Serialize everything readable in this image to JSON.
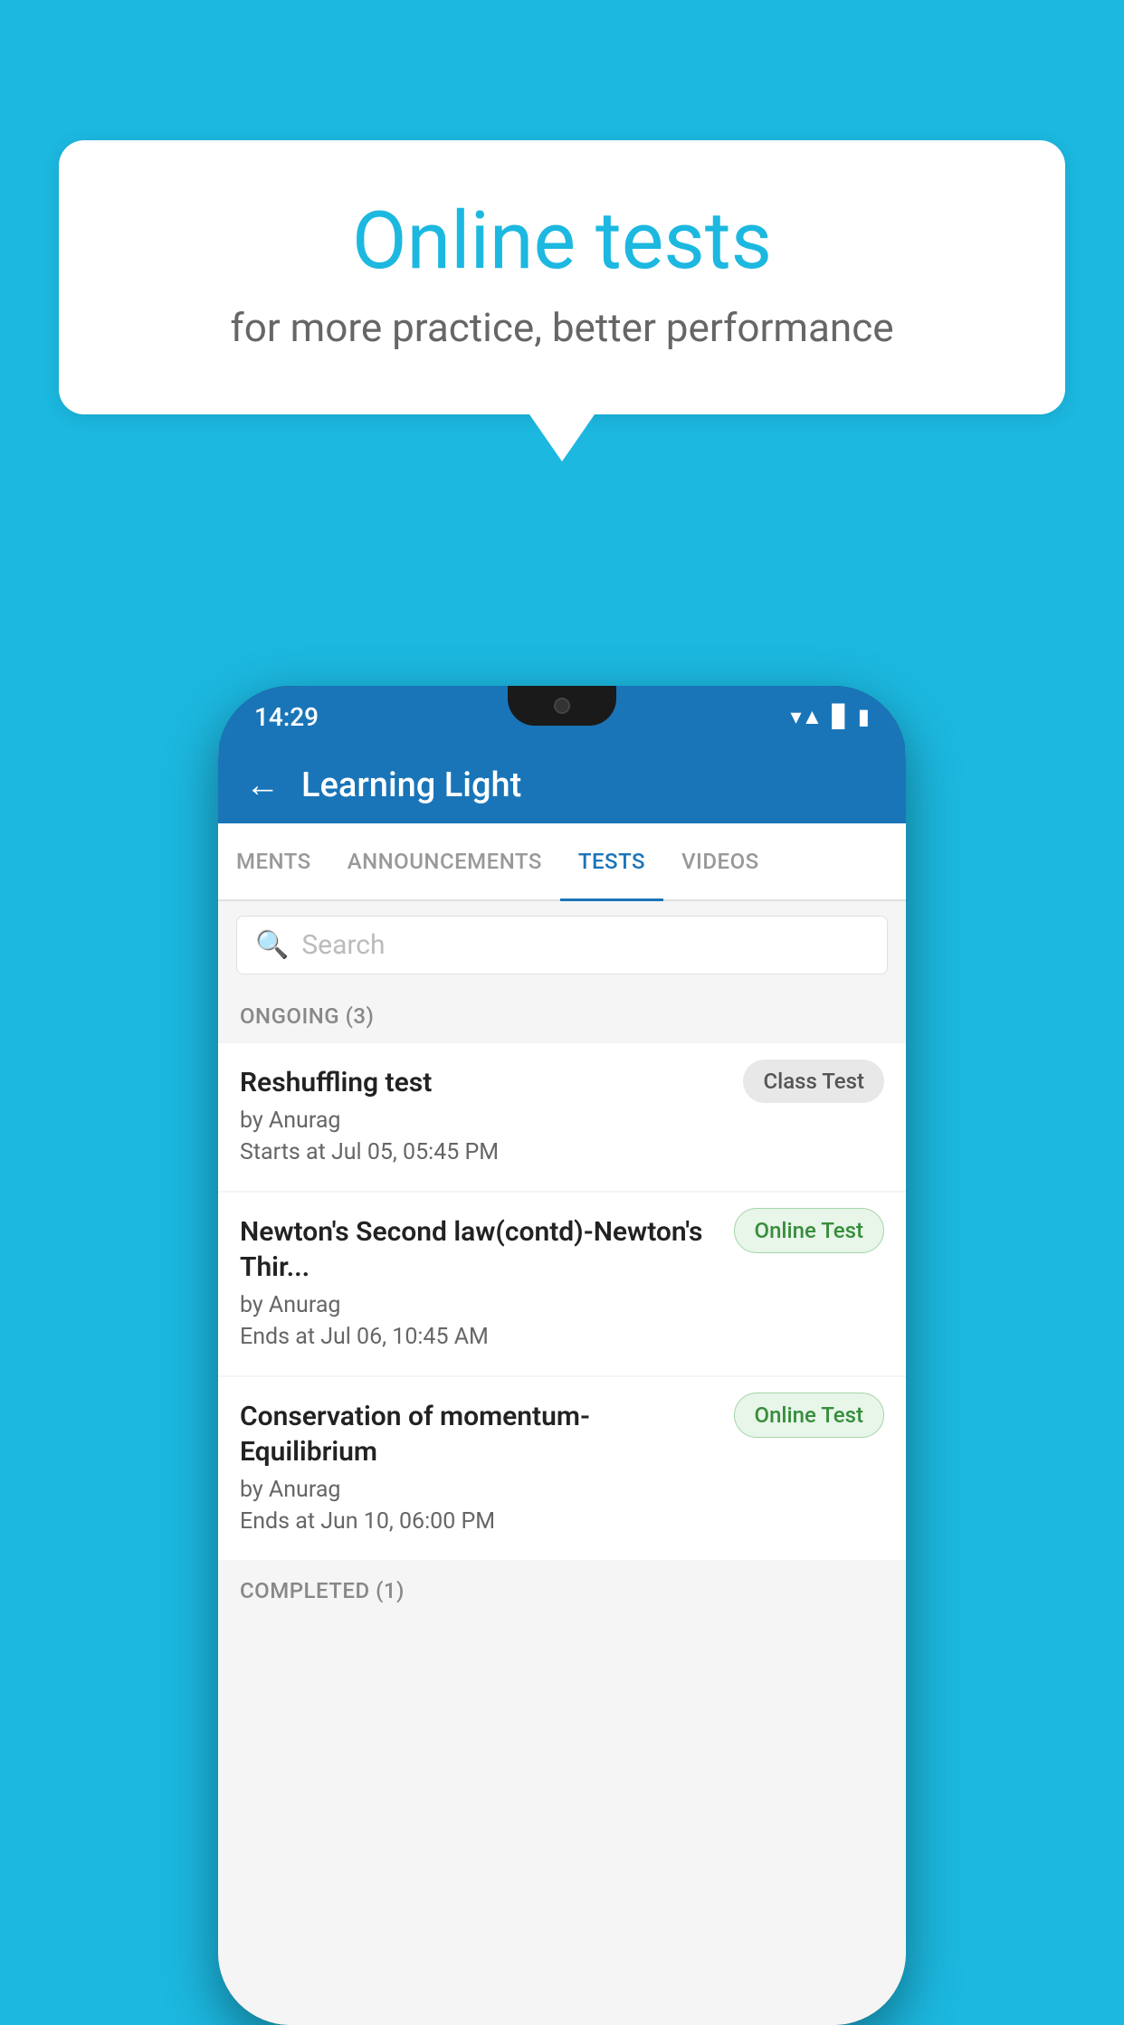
{
  "background_color": "#1cb8e0",
  "speech_bubble": {
    "title": "Online tests",
    "subtitle": "for more practice, better performance"
  },
  "phone": {
    "status_bar": {
      "time": "14:29",
      "icons": [
        "wifi",
        "signal",
        "battery"
      ]
    },
    "header": {
      "title": "Learning Light",
      "back_label": "←"
    },
    "tabs": [
      {
        "label": "MENTS",
        "active": false
      },
      {
        "label": "ANNOUNCEMENTS",
        "active": false
      },
      {
        "label": "TESTS",
        "active": true
      },
      {
        "label": "VIDEOS",
        "active": false
      }
    ],
    "search": {
      "placeholder": "Search"
    },
    "sections": [
      {
        "header": "ONGOING (3)",
        "items": [
          {
            "name": "Reshuffling test",
            "author": "by Anurag",
            "date": "Starts at  Jul 05, 05:45 PM",
            "badge": "Class Test",
            "badge_type": "class"
          },
          {
            "name": "Newton's Second law(contd)-Newton's Thir...",
            "author": "by Anurag",
            "date": "Ends at  Jul 06, 10:45 AM",
            "badge": "Online Test",
            "badge_type": "online"
          },
          {
            "name": "Conservation of momentum-Equilibrium",
            "author": "by Anurag",
            "date": "Ends at  Jun 10, 06:00 PM",
            "badge": "Online Test",
            "badge_type": "online"
          }
        ]
      },
      {
        "header": "COMPLETED (1)",
        "items": []
      }
    ]
  }
}
